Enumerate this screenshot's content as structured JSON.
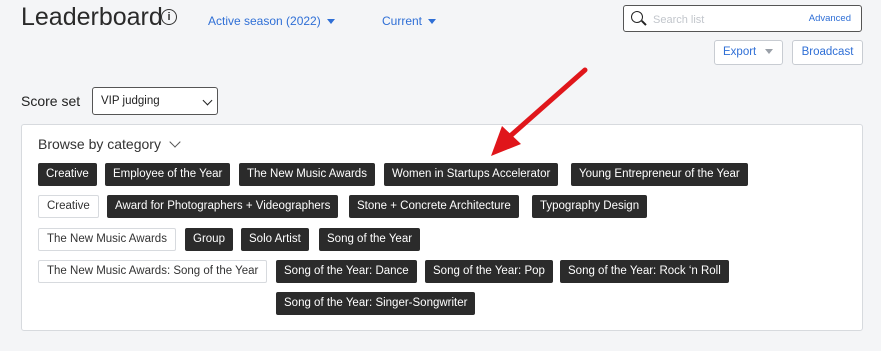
{
  "header": {
    "title": "Leaderboard",
    "info_icon": "info-icon",
    "season_dropdown": "Active season (2022)",
    "status_dropdown": "Current"
  },
  "search": {
    "placeholder": "Search list",
    "advanced_label": "Advanced"
  },
  "toolbar": {
    "export_label": "Export",
    "broadcast_label": "Broadcast"
  },
  "score_set": {
    "label": "Score set",
    "selected": "VIP judging"
  },
  "browse": {
    "title": "Browse by category",
    "rows": [
      {
        "tags": [
          {
            "label": "Creative",
            "style": "dark"
          },
          {
            "label": "Employee of the Year",
            "style": "dark"
          },
          {
            "label": "The New Music Awards",
            "style": "dark"
          },
          {
            "label": "Women in Startups Accelerator",
            "style": "dark"
          },
          {
            "label": "Young Entrepreneur of the Year",
            "style": "dark"
          }
        ]
      },
      {
        "tags": [
          {
            "label": "Creative",
            "style": "light"
          },
          {
            "label": "Award for Photographers + Videographers",
            "style": "dark"
          },
          {
            "label": "Stone + Concrete Architecture",
            "style": "dark"
          },
          {
            "label": "Typography Design",
            "style": "dark"
          }
        ]
      },
      {
        "tags": [
          {
            "label": "The New Music Awards",
            "style": "light"
          },
          {
            "label": "Group",
            "style": "dark"
          },
          {
            "label": "Solo Artist",
            "style": "dark"
          },
          {
            "label": "Song of the Year",
            "style": "dark"
          }
        ]
      },
      {
        "tags": [
          {
            "label": "The New Music Awards: Song of the Year",
            "style": "light"
          },
          {
            "label": "Song of the Year: Dance",
            "style": "dark"
          },
          {
            "label": "Song of the Year: Pop",
            "style": "dark"
          },
          {
            "label": "Song of the Year: Rock ‘n Roll",
            "style": "dark"
          }
        ]
      },
      {
        "tags": [
          {
            "label": "Song of the Year: Singer-Songwriter",
            "style": "dark"
          }
        ]
      }
    ]
  },
  "annotation": {
    "arrow_color": "#e0161b"
  },
  "colors": {
    "link": "#2f6fd6",
    "tag_dark": "#2b2b2b",
    "background": "#f4f5f7"
  }
}
